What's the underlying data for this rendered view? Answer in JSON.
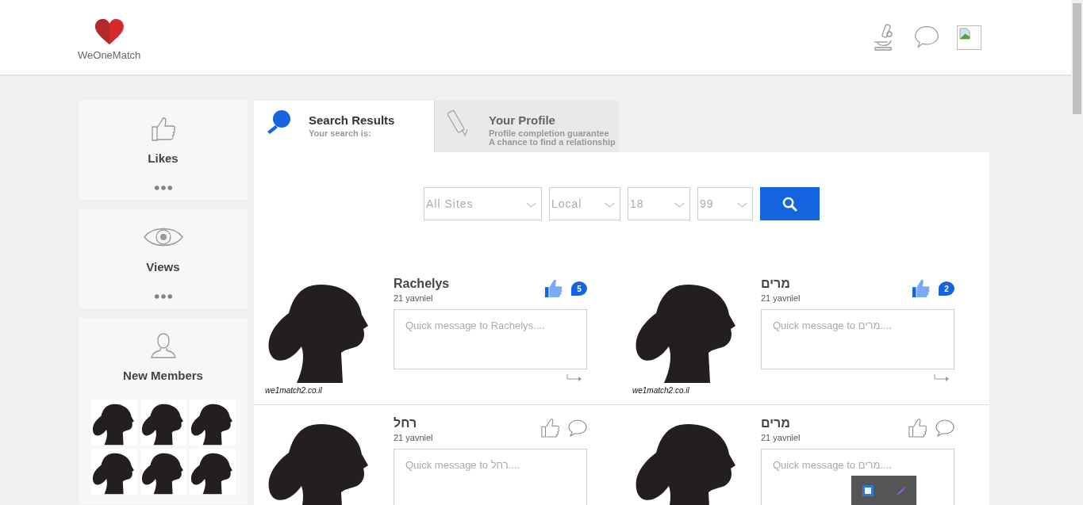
{
  "header": {
    "logo_text": "WeOneMatch"
  },
  "sidebar": [
    {
      "kind": "counter",
      "label": "Likes"
    },
    {
      "kind": "counter",
      "label": "Views"
    },
    {
      "kind": "members",
      "label": "New Members"
    }
  ],
  "tabs": [
    {
      "title": "Search Results",
      "lines": [
        "Your search is:"
      ],
      "selected": true
    },
    {
      "title": "Your Profile",
      "lines": [
        "Profile completion guarantee",
        "A chance to find a relationship"
      ],
      "selected": false
    }
  ],
  "search": {
    "fields": [
      {
        "value": "All Sites"
      },
      {
        "value": "Local"
      },
      {
        "value": "18"
      },
      {
        "value": "99"
      }
    ]
  },
  "profiles": [
    {
      "name": "Rachelys",
      "location": "21 yavniel",
      "liked": true,
      "messages": "5",
      "placeholder": "Quick message to Rachelys....",
      "caption": "we1match2.co.il"
    },
    {
      "name": "מרים",
      "location": "21 yavniel",
      "liked": true,
      "messages": "2",
      "placeholder": "Quick message to מרים....",
      "caption": "we1match2.co.il"
    },
    {
      "name": "רחל",
      "location": "21 yavniel",
      "liked": false,
      "placeholder": "Quick message to רחל...."
    },
    {
      "name": "מרים",
      "location": "21 yavniel",
      "liked": false,
      "placeholder": "Quick message to מרים...."
    }
  ]
}
